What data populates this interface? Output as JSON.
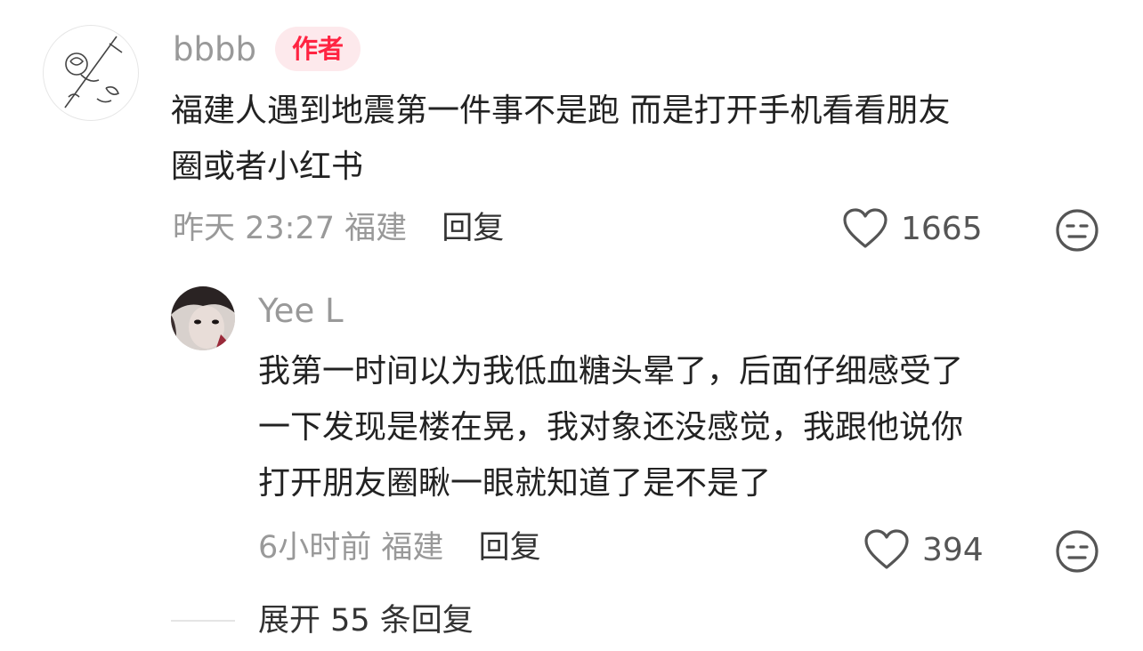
{
  "comment": {
    "username": "bbbb",
    "author_badge": "作者",
    "text": "福建人遇到地震第一件事不是跑 而是打开手机看看朋友\n圈或者小红书",
    "time": "昨天 23:27",
    "location": "福建",
    "reply_label": "回复",
    "like_count": "1665",
    "like_icon": "heart-outline-icon",
    "react_icon": "neutral-face-icon"
  },
  "reply": {
    "username": "Yee L",
    "text": "我第一时间以为我低血糖头晕了，后面仔细感受了\n一下发现是楼在晃，我对象还没感觉，我跟他说你\n打开朋友圈瞅一眼就知道了是不是了",
    "time": "6小时前",
    "location": "福建",
    "reply_label": "回复",
    "like_count": "394",
    "like_icon": "heart-outline-icon",
    "react_icon": "neutral-face-icon"
  },
  "expand": {
    "label": "展开 55 条回复"
  },
  "colors": {
    "accent": "#ff2442",
    "badge_bg": "#fde9ec",
    "muted_text": "#999999",
    "body_text": "#222222"
  }
}
